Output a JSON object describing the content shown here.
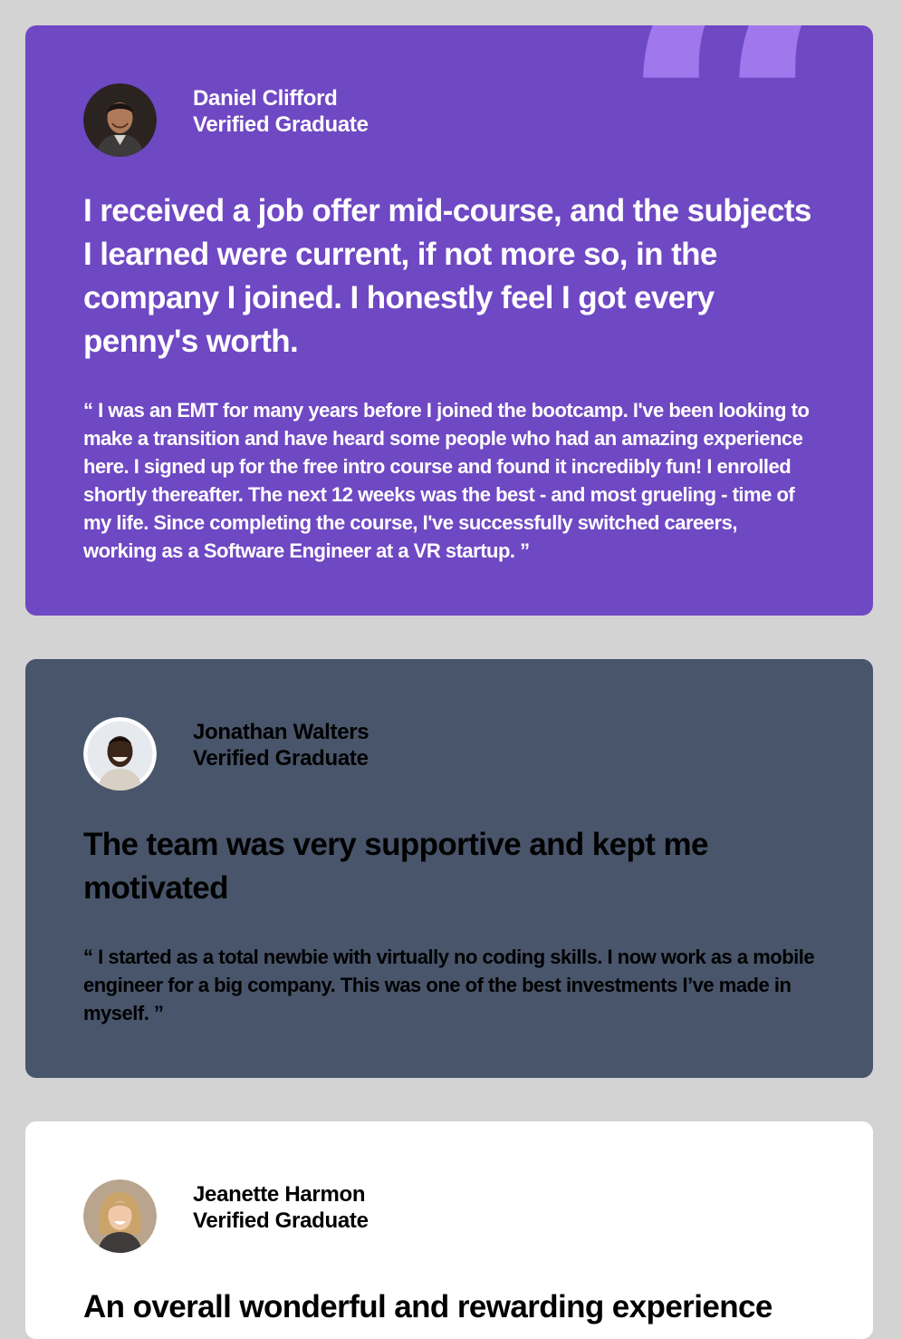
{
  "testimonials": [
    {
      "name": "Daniel Clifford",
      "role": "Verified Graduate",
      "headline": "I received a job offer mid-course, and the subjects I learned were current, if not more so, in the company I joined. I honestly feel I got every penny's worth.",
      "quote": "“ I was an EMT for many years before I joined the bootcamp. I've been looking to make a transition and have heard some people who had an amazing experience here. I signed up for the free intro course and found it incredibly fun! I enrolled shortly thereafter. The next 12 weeks was the best - and most grueling - time of my life. Since completing the course, I've successfully switched careers, working as a Software Engineer at a VR startup. ”",
      "background": "#6f48c3",
      "text_color": "#ffffff"
    },
    {
      "name": "Jonathan Walters",
      "role": "Verified Graduate",
      "headline": "The team was very supportive and kept me motivated",
      "quote": "“ I started as a total newbie with virtually no coding skills. I now work as a mobile engineer for a big company. This was one of the best investments I’ve made in myself. ”",
      "background": "#48556a",
      "text_color": "#000000"
    },
    {
      "name": "Jeanette Harmon",
      "role": "Verified Graduate",
      "headline": "An overall wonderful and rewarding experience",
      "background": "#ffffff",
      "text_color": "#000000"
    }
  ],
  "decoration": {
    "quote_mark": "“",
    "quote_mark_color": "#a077ec"
  },
  "page_background": "#d3d3d3"
}
